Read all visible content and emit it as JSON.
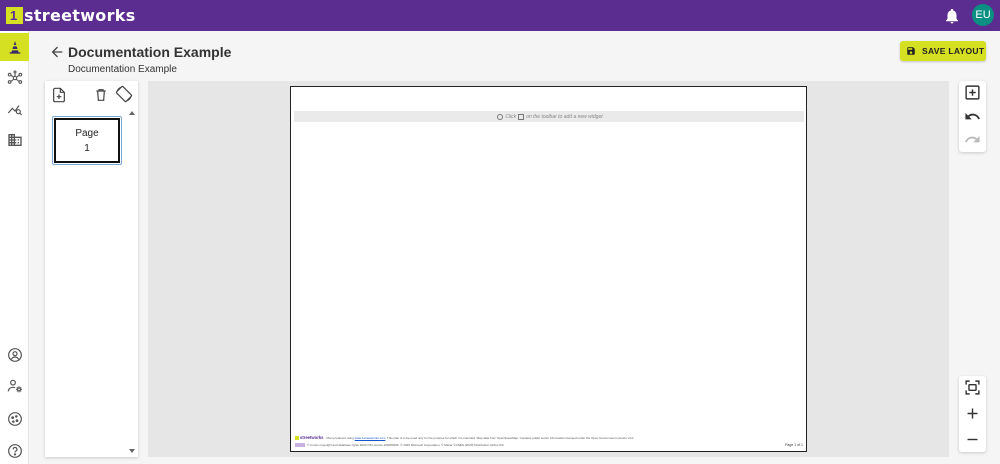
{
  "app": {
    "logo_mark": "1",
    "logo_text": "streetworks",
    "user_initials": "EU",
    "colors": {
      "brand": "#5b2d91",
      "accent": "#d4e021",
      "avatar": "#0a8f82"
    }
  },
  "nav": {
    "top_icons": [
      "traffic-cone-icon",
      "network-icon",
      "analytics-icon",
      "buildings-icon"
    ],
    "bottom_icons": [
      "account-icon",
      "user-settings-icon",
      "cookie-icon",
      "help-icon"
    ]
  },
  "header": {
    "title": "Documentation Example",
    "subtitle": "Documentation Example",
    "save_label": "SAVE LAYOUT"
  },
  "pages_panel": {
    "pages": [
      {
        "label": "Page",
        "number": "1"
      }
    ]
  },
  "sheet": {
    "hint_prefix": "Click",
    "hint_suffix": "on the toolbar to add a new widget",
    "footer_logo": "streetworks",
    "footer_line1_a": "Plan produced using",
    "footer_line1_link": "www.1streetworks.com",
    "footer_line1_b": ". This plan is to be used only for the purpose for which it is intended.   Map data from OpenStreetMap.   Contains public sector information licensed under the Open Government Licence v3.0.",
    "footer_line2": "© Crown copyright and database rights 2020 OS Licence 100059369.   © 2020 Microsoft Corporation, © Maxar ©CNES (2020) Distribution Airbus DS",
    "page_label": "Page 1 of 1"
  }
}
